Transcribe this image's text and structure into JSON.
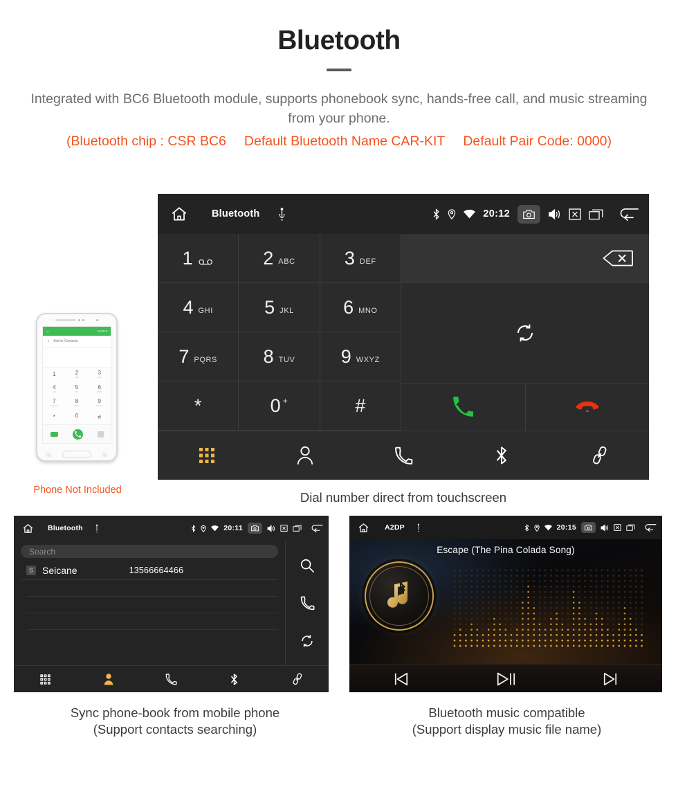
{
  "header": {
    "title": "Bluetooth",
    "subtitle": "Integrated with BC6 Bluetooth module, supports phonebook sync, hands-free call, and music streaming from your phone.",
    "spec_chip": "(Bluetooth chip : CSR BC6",
    "spec_name": "Default Bluetooth Name CAR-KIT",
    "spec_pair": "Default Pair Code: 0000)",
    "accent_color": "#f4531f",
    "subtitle_color": "#6e6e6e"
  },
  "dialer": {
    "statusbar": {
      "home_icon": "home-icon",
      "title": "Bluetooth",
      "usb_icon": "usb-icon",
      "bluetooth_icon": "bluetooth-icon",
      "location_icon": "location-icon",
      "wifi_icon": "wifi-icon",
      "clock": "20:12",
      "camera_icon": "camera-icon",
      "volume_icon": "volume-icon",
      "close_icon": "close-icon",
      "recents_icon": "recents-icon",
      "back_icon": "back-icon"
    },
    "keys": [
      {
        "digit": "1",
        "sub": "",
        "voicemail": true
      },
      {
        "digit": "2",
        "sub": "ABC",
        "voicemail": false
      },
      {
        "digit": "3",
        "sub": "DEF",
        "voicemail": false
      },
      {
        "digit": "4",
        "sub": "GHI",
        "voicemail": false
      },
      {
        "digit": "5",
        "sub": "JKL",
        "voicemail": false
      },
      {
        "digit": "6",
        "sub": "MNO",
        "voicemail": false
      },
      {
        "digit": "7",
        "sub": "PQRS",
        "voicemail": false
      },
      {
        "digit": "8",
        "sub": "TUV",
        "voicemail": false
      },
      {
        "digit": "9",
        "sub": "WXYZ",
        "voicemail": false
      },
      {
        "digit": "*",
        "sub": "",
        "voicemail": false
      },
      {
        "digit": "0",
        "sub": "+",
        "voicemail": false
      },
      {
        "digit": "#",
        "sub": "",
        "voicemail": false
      }
    ],
    "number_value": "",
    "backspace_icon": "backspace-icon",
    "sync_icon": "sync-icon",
    "call_icon": "call-icon",
    "hangup_icon": "hangup-icon",
    "call_color": "#22c33c",
    "hangup_color": "#e8320f",
    "nav": [
      {
        "name": "dialpad",
        "icon": "dialpad-icon",
        "active": true
      },
      {
        "name": "contacts",
        "icon": "contact-icon",
        "active": false
      },
      {
        "name": "call-log",
        "icon": "handset-icon",
        "active": false
      },
      {
        "name": "bluetooth",
        "icon": "bluetooth-icon",
        "active": false
      },
      {
        "name": "link",
        "icon": "link-icon",
        "active": false
      }
    ],
    "active_color": "#f0b44a",
    "caption": "Dial number direct from touchscreen"
  },
  "phone_mock": {
    "appbar_more": "MORE",
    "add_label": "Add to Contacts",
    "keys": [
      {
        "d": "1",
        "s": ""
      },
      {
        "d": "2",
        "s": "ABC"
      },
      {
        "d": "3",
        "s": "DEF"
      },
      {
        "d": "4",
        "s": "GHI"
      },
      {
        "d": "5",
        "s": "JKL"
      },
      {
        "d": "6",
        "s": "MNO"
      },
      {
        "d": "7",
        "s": "PQRS"
      },
      {
        "d": "8",
        "s": "TUV"
      },
      {
        "d": "9",
        "s": "WXYZ"
      },
      {
        "d": "*",
        "s": ""
      },
      {
        "d": "0",
        "s": "+"
      },
      {
        "d": "#",
        "s": ""
      }
    ],
    "note": "Phone Not Included",
    "note_color": "#f4531f",
    "brand_green": "#3fbb54"
  },
  "phonebook": {
    "statusbar": {
      "title": "Bluetooth",
      "clock": "20:11"
    },
    "search_placeholder": "Search",
    "contacts": [
      {
        "initial": "S",
        "name": "Seicane",
        "number": "13566664466"
      }
    ],
    "side_icons": [
      "search-icon",
      "handset-icon",
      "sync-icon"
    ],
    "nav": [
      {
        "name": "dialpad",
        "active": false
      },
      {
        "name": "contacts",
        "active": true
      },
      {
        "name": "call-log",
        "active": false
      },
      {
        "name": "bluetooth",
        "active": false
      },
      {
        "name": "link",
        "active": false
      }
    ],
    "caption_line1": "Sync phone-book from mobile phone",
    "caption_line2": "(Support contacts searching)"
  },
  "music": {
    "statusbar": {
      "title": "A2DP",
      "clock": "20:15"
    },
    "song_title": "Escape (The Pina Colada Song)",
    "controls": [
      {
        "name": "previous",
        "icon": "previous-icon"
      },
      {
        "name": "play-pause",
        "icon": "play-pause-icon"
      },
      {
        "name": "next",
        "icon": "next-icon"
      }
    ],
    "gold_color": "#caa14e",
    "caption_line1": "Bluetooth music compatible",
    "caption_line2": "(Support display music file name)"
  }
}
